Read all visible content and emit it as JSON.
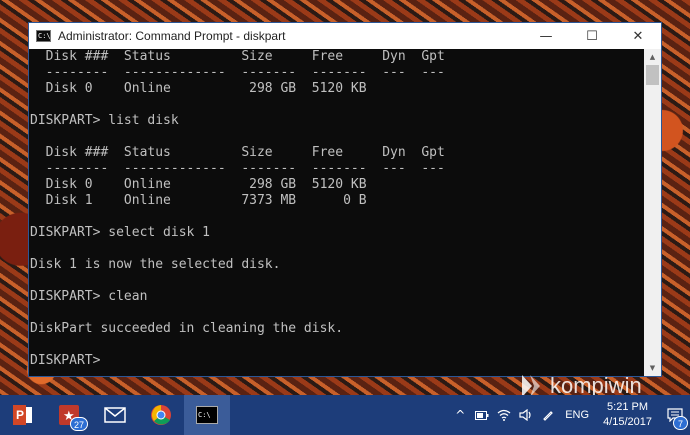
{
  "window": {
    "title": "Administrator: Command Prompt - diskpart",
    "icon_text": "C:\\",
    "controls": {
      "minimize": "—",
      "maximize": "☐",
      "close": "✕"
    }
  },
  "console": {
    "lines": [
      "  Disk ###  Status         Size     Free     Dyn  Gpt",
      "  --------  -------------  -------  -------  ---  ---",
      "  Disk 0    Online          298 GB  5120 KB",
      "",
      "DISKPART> list disk",
      "",
      "  Disk ###  Status         Size     Free     Dyn  Gpt",
      "  --------  -------------  -------  -------  ---  ---",
      "  Disk 0    Online          298 GB  5120 KB",
      "  Disk 1    Online         7373 MB      0 B",
      "",
      "DISKPART> select disk 1",
      "",
      "Disk 1 is now the selected disk.",
      "",
      "DISKPART> clean",
      "",
      "DiskPart succeeded in cleaning the disk.",
      "",
      "DISKPART> "
    ]
  },
  "watermark": {
    "text": "kompiwin"
  },
  "taskbar": {
    "apps": [
      {
        "name": "powerpoint",
        "label": "P",
        "color": "#d24726"
      },
      {
        "name": "photo-app",
        "label": "★",
        "color": "#c0392b",
        "badge": "27"
      },
      {
        "name": "mail",
        "label": "✉",
        "color": "#ffffff"
      },
      {
        "name": "chrome",
        "label": "",
        "color": "#db4437"
      },
      {
        "name": "command-prompt",
        "label": "C:\\",
        "color": "#000000"
      }
    ],
    "tray": {
      "chevron": "^",
      "language": "ENG",
      "time": "5:21 PM",
      "date": "4/15/2017",
      "notifications": "7"
    }
  }
}
